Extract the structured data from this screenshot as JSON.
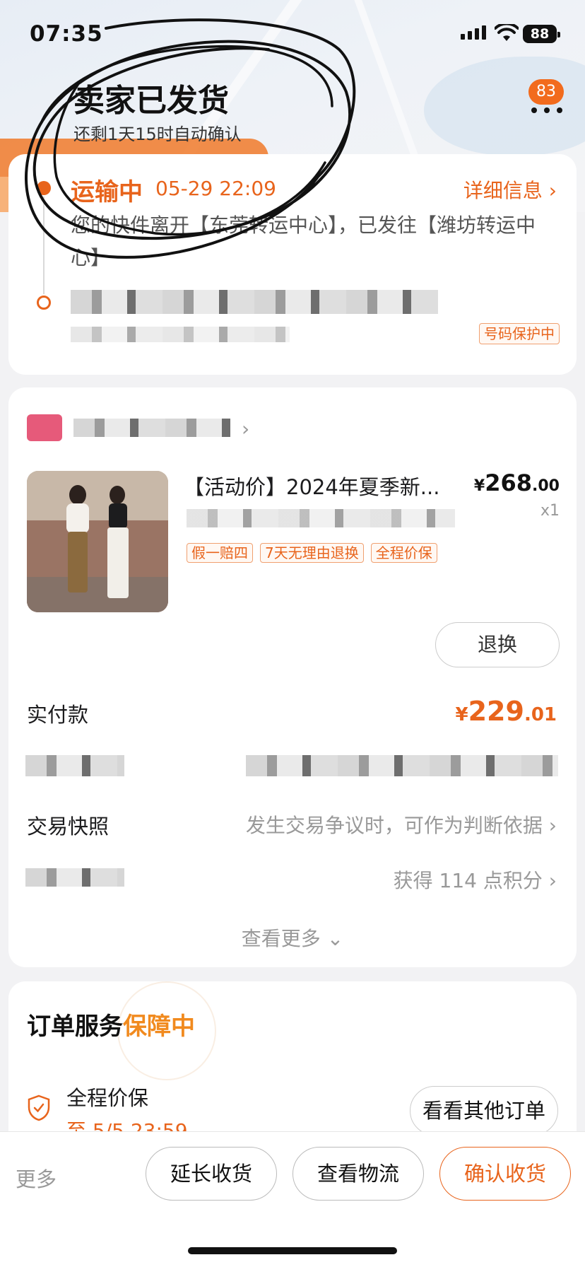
{
  "status_bar": {
    "time": "07:35",
    "battery": "88"
  },
  "header": {
    "title": "卖家已发货",
    "subtitle": "还剩1天15时自动确认",
    "message_badge": "83"
  },
  "logistics": {
    "status": "运输中",
    "time": "05-29 22:09",
    "detail_link": "详细信息 ›",
    "message": "您的快件离开【东莞转运中心】，已发往【潍坊转运中心】",
    "phone_protect": "号码保护中"
  },
  "order": {
    "product_title": "【活动价】2024年夏季新...",
    "price_symbol": "¥",
    "price_int": "268",
    "price_dec": ".00",
    "quantity": "x1",
    "tags": [
      "假一赔四",
      "7天无理由退换",
      "全程价保"
    ],
    "return_button": "退换",
    "paid_label": "实付款",
    "paid_symbol": "¥",
    "paid_int": "229",
    "paid_dec": ".01",
    "snapshot_label": "交易快照",
    "snapshot_value": "发生交易争议时，可作为判断依据",
    "points_value": "获得 114 点积分",
    "see_more": "查看更多"
  },
  "service": {
    "title": "订单服务",
    "title_highlight": "保障中",
    "item_name": "全程价保",
    "item_date": "至 5/5 23:59",
    "other_orders_button": "看看其他订单"
  },
  "bottom_bar": {
    "more": "更多",
    "extend": "延长收货",
    "logistics": "查看物流",
    "confirm": "确认收货"
  },
  "colors": {
    "accent": "#e8641c",
    "badge": "#f26b1d",
    "highlight": "#f18a1e"
  }
}
